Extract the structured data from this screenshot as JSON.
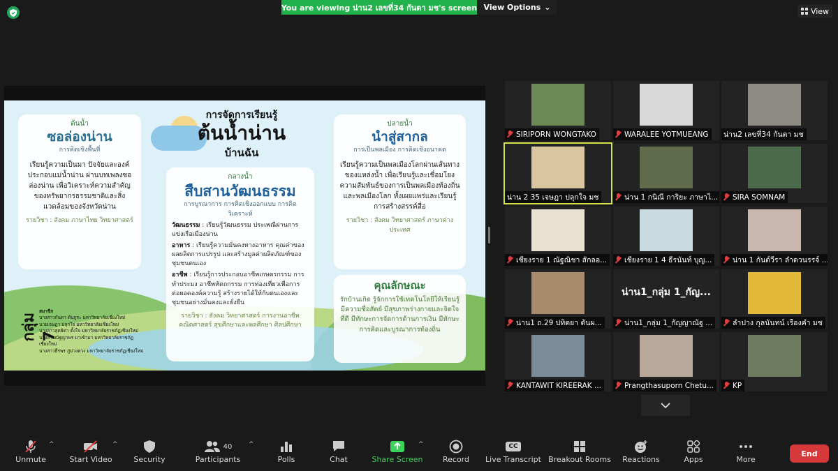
{
  "banner": {
    "text": "You are viewing น่าน2 เลขที่34 กันตา มช's screen",
    "view_options": "View Options"
  },
  "view_button": "View",
  "slide": {
    "title_top": "การจัดการเรียนรู้",
    "title_main": "ต้นน้ำน่าน",
    "title_bottom": "บ้านฉัน",
    "card1": {
      "kicker": "ต้นน้ำ",
      "heading": "ซอล่องน่าน",
      "sub": "การคิดเชิงพื้นที่",
      "body": "เรียนรู้ความเป็นมา ปัจจัยและองค์ประกอบแม่น้ำน่าน ผ่านบทเพลงซอล่องน่าน เพื่อวิเคราะห์ความสำคัญของทรัพยากรธรรมชาติและสิ่งแวดล้อมของจังหวัดน่าน",
      "subject": "รายวิชา : สังคม ภาษาไทย วิทยาศาสตร์"
    },
    "card2": {
      "kicker": "กลางน้ำ",
      "heading": "สืบสานวัฒนธรรม",
      "sub": "การบูรณาการ การคิดเชิงออกแบบ การคิดวิเคราะห์",
      "items": [
        {
          "label": "วัฒนธรรม",
          "text": " : เรียนรู้วัฒนธรรม ประเพณีผ่านการแข่งเรือเมืองน่าน"
        },
        {
          "label": "อาหาร",
          "text": " : เรียนรู้ความมั่นคงทางอาหาร คุณค่าของผลผลิตการแปรรูป และสร้างมูลค่าผลิตภัณฑ์ของชุมชนตนเอง"
        },
        {
          "label": "อาชีพ",
          "text": " : เรียนรู้การประกอบอาชีพเกษตรกรรม การทำประมง อาชีพหัตถกรรม การท่องเที่ยวเพื่อการต่อยอดองค์ความรู้ สร้างรายได้ให้กับตนเองและชุมชนอย่างมั่นคงและยั่งยืน"
        }
      ],
      "subject": "รายวิชา : สังคม วิทยาศาสตร์ การงานอาชีพ คณิตศาสตร์ สุขศึกษาและพลศึกษา ศิลปศึกษา"
    },
    "card3": {
      "kicker": "ปลายน้ำ",
      "heading": "นำสู่สากล",
      "sub": "การเป็นพลเมือง การคิดเชิงอนาคต",
      "body": "เรียนรู้ความเป็นพลเมืองโลกผ่านเส้นทางของแหล่งน้ำ เพื่อเรียนรู้และเชื่อมโยงความสัมพันธ์ของการเป็นพลเมืองท้องถิ่นและพลเมืองโลก ทั้งเผยแพร่และเรียนรู้การสร้างสรรค์สื่อ",
      "subject": "รายวิชา : สังคม วิทยาศาสตร์ ภาษาต่างประเทศ"
    },
    "card4": {
      "heading": "คุณลักษณะ",
      "body": "รักบ้านเกิด รู้จักการใช้เทคโนโลยีให้เรียนรู้ มีความซื่อสัตย์ มีสุขภาพร่างกายและจิตใจที่ดี มีทักษะการจัดการด้านการเงิน มีทักษะการคิดและบูรณาการท้องถิ่น"
    },
    "group": {
      "label": "กลุ่ม 7",
      "members_title": "สมาชิก",
      "members": [
        "นางสาวกันตา ตันกูระ มหาวิทยาลัยเชียงใหม่",
        "นายเจษฎา ปลุกใจ มหาวิทยาลัยเชียงใหม่",
        "นางสาวสุดธิดา ตั้งใจ มหาวิทยาลัยราชภัฏเชียงใหม่",
        "นางสาวณัฐญาพร มาเข้ามา มหาวิทยาลัยราชภัฏเชียงใหม่",
        "นางสาวธีรพร ภู่ม่วงดวง มหาวิทยาลัยราชภัฏเชียงใหม่"
      ]
    }
  },
  "participants": [
    {
      "name": "SIRIPORN WONGTAKO",
      "muted": true,
      "bg": "#6b8a56"
    },
    {
      "name": "WARALEE YOTMUEANG",
      "muted": true,
      "bg": "#d9d9d9"
    },
    {
      "name": "น่าน2 เลขที่34 กันตา มช",
      "muted": false,
      "bg": "#8d8a84"
    },
    {
      "name": "น่าน 2 35 เจษฎา ปลุกใจ มช",
      "muted": false,
      "bg": "#d9c6a0",
      "active": true
    },
    {
      "name": "น่าน 1 กนิณี การิยะ ภาษาไ...",
      "muted": true,
      "bg": "#5f6b4a"
    },
    {
      "name": "SIRA SOMNAM",
      "muted": true,
      "bg": "#4a6a4a"
    },
    {
      "name": "เชียงราย 1 ณัฐณิชา สักลอ...",
      "muted": true,
      "bg": "#e8e0d0"
    },
    {
      "name": "เชียงราย 1 4 ธีรนันท์ บุญ...",
      "muted": true,
      "bg": "#c9d9e0"
    },
    {
      "name": "น่าน 1 กันต์วีรา ลำดวนรรจ์ ...",
      "muted": true,
      "bg": "#c9b6ad"
    },
    {
      "name": "น่าน1 ถ.29 ปทิตยา ตันผ...",
      "muted": true,
      "bg": "#a88b6d"
    },
    {
      "name": "น่าน1_กลุ่ม 1_กัญญาณัฐ ...",
      "muted": true,
      "bg": "",
      "big_label": "น่าน1_กลุ่ม 1_กัญ..."
    },
    {
      "name": "ลำปาง กุลนันทน์ เรืองคำ มช",
      "muted": true,
      "bg": "#e3b93a"
    },
    {
      "name": "KANTAWIT KIREERAK ...",
      "muted": true,
      "bg": "#7a8b9a"
    },
    {
      "name": "Prangthasuporn Chetu...",
      "muted": true,
      "bg": "#b7a89a"
    },
    {
      "name": "KP",
      "muted": true,
      "bg": "#6d7a5d"
    }
  ],
  "toolbar": {
    "unmute": "Unmute",
    "start_video": "Start Video",
    "security": "Security",
    "participants": "Participants",
    "participants_count": "40",
    "polls": "Polls",
    "chat": "Chat",
    "share_screen": "Share Screen",
    "record": "Record",
    "live_transcript": "Live Transcript",
    "breakout_rooms": "Breakout Rooms",
    "reactions": "Reactions",
    "apps": "Apps",
    "more": "More",
    "end": "End",
    "cc": "CC"
  }
}
